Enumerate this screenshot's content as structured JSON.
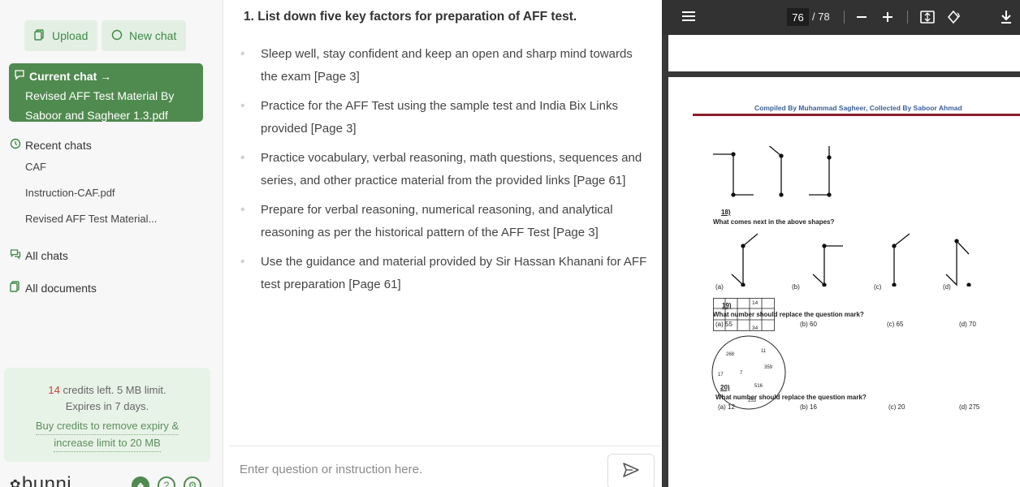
{
  "sidebar": {
    "upload_label": "Upload",
    "new_chat_label": "New chat",
    "current_chat_heading": "Current chat →",
    "current_chat_line1": "Revised AFF Test Material By",
    "current_chat_line2": "Saboor and Sagheer 1.3.pdf",
    "recent_heading": "Recent chats",
    "recent": [
      "CAF",
      "Instruction-CAF.pdf",
      "Revised AFF Test Material..."
    ],
    "all_chats_label": "All chats",
    "all_documents_label": "All documents",
    "credits_count": "14",
    "credits_text": " credits left. 5 MB limit.",
    "expires_text": "Expires in 7 days.",
    "buy_line1": "Buy credits to remove expiry &",
    "buy_line2": "increase limit to 20 MB",
    "logo_text": "bunni"
  },
  "chat": {
    "question": "1. List down five key factors for preparation of AFF test.",
    "answers": [
      "Sleep well, stay confident and keep an open and sharp mind towards the exam [Page 3]",
      "Practice for the AFF Test using the sample test and India Bix Links provided [Page 3]",
      "Practice vocabulary, verbal reasoning, math questions, sequences and series, and other practice material from the provided links [Page 61]",
      "Prepare for verbal reasoning, numerical reasoning, and analytical reasoning as per the historical pattern of the AFF Test [Page 3]",
      "Use the guidance and material provided by Sir Hassan Khanani for AFF test preparation [Page 61]"
    ],
    "input_placeholder": "Enter question or instruction here."
  },
  "viewer": {
    "current_page": "76",
    "total_pages": "/ 78",
    "pdf": {
      "header": "Compiled By Muhammad Sagheer, Collected By Saboor Ahmad",
      "q18_num": "18)",
      "q18_text": "What comes next in the above shapes?",
      "q18_options": [
        "(a)",
        "(b)",
        "(c)",
        "(d)"
      ],
      "q19_num": "19)",
      "q19_text": "What number should replace the question mark?",
      "q19_options": [
        "(a) 55",
        "(b) 60",
        "(c) 65",
        "(d) 70"
      ],
      "q19_grid": [
        "14",
        "34"
      ],
      "q20_num": "20)",
      "q20_text": "What number should replace the question mark?",
      "q20_options": [
        "(a) 12",
        "(b) 16",
        "(c) 20",
        "(d) 275"
      ],
      "q20_circle": [
        "11",
        "268",
        "359",
        "7",
        "17",
        "516",
        "253"
      ]
    }
  },
  "colors": {
    "accent_green": "#4f8a4f",
    "credits_red": "#d23c3c",
    "pdf_header_blue": "#3a5f9a",
    "pdf_rule": "#8b1e2a"
  }
}
